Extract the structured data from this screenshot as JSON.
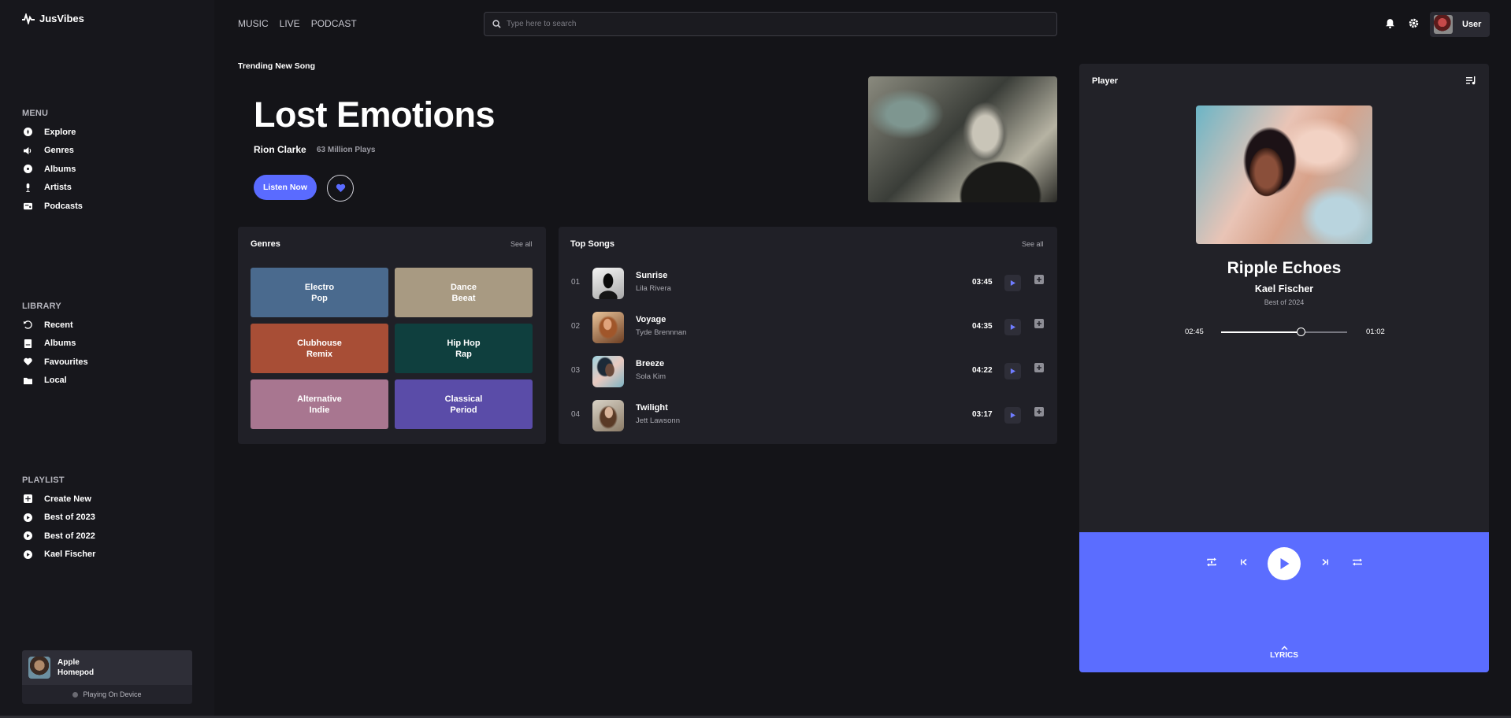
{
  "app": {
    "name": "JusVibes"
  },
  "sidebar": {
    "menu_title": "MENU",
    "menu_items": [
      {
        "label": "Explore",
        "icon": "explore-icon"
      },
      {
        "label": "Genres",
        "icon": "speaker-icon"
      },
      {
        "label": "Albums",
        "icon": "disc-icon"
      },
      {
        "label": "Artists",
        "icon": "microphone-icon"
      },
      {
        "label": "Podcasts",
        "icon": "radio-icon"
      }
    ],
    "library_title": "LIBRARY",
    "library_items": [
      {
        "label": "Recent",
        "icon": "history-icon"
      },
      {
        "label": "Albums",
        "icon": "album-icon"
      },
      {
        "label": "Favourites",
        "icon": "heart-icon"
      },
      {
        "label": "Local",
        "icon": "folder-icon"
      }
    ],
    "playlist_title": "PLAYLIST",
    "playlist_items": [
      {
        "label": "Create New",
        "icon": "plus-icon"
      },
      {
        "label": "Best of 2023",
        "icon": "play-circle-icon"
      },
      {
        "label": "Best of 2022",
        "icon": "play-circle-icon"
      },
      {
        "label": "Kael Fischer",
        "icon": "play-circle-icon"
      }
    ],
    "device": {
      "name": "Apple Homepod",
      "status": "Playing On Device"
    }
  },
  "topbar": {
    "nav": [
      "MUSIC",
      "LIVE",
      "PODCAST"
    ],
    "search_placeholder": "Type here to search",
    "user_label": "User"
  },
  "hero": {
    "label": "Trending New Song",
    "title": "Lost Emotions",
    "artist": "Rion Clarke",
    "plays": "63 Million Plays",
    "listen_label": "Listen Now"
  },
  "genres": {
    "title": "Genres",
    "see_all": "See all",
    "items": [
      {
        "label": "Electro\nPop",
        "color": "#4a6a8e"
      },
      {
        "label": "Dance\nBeeat",
        "color": "#a89a82"
      },
      {
        "label": "Clubhouse\nRemix",
        "color": "#a84e36"
      },
      {
        "label": "Hip Hop\nRap",
        "color": "#0f3f3e"
      },
      {
        "label": "Alternative\nIndie",
        "color": "#a87690"
      },
      {
        "label": "Classical\nPeriod",
        "color": "#5a4ca8"
      }
    ]
  },
  "top_songs": {
    "title": "Top Songs",
    "see_all": "See all",
    "items": [
      {
        "num": "01",
        "title": "Sunrise",
        "artist": "Lila Rivera",
        "duration": "03:45"
      },
      {
        "num": "02",
        "title": "Voyage",
        "artist": "Tyde Brennnan",
        "duration": "04:35"
      },
      {
        "num": "03",
        "title": "Breeze",
        "artist": "Sola Kim",
        "duration": "04:22"
      },
      {
        "num": "04",
        "title": "Twilight",
        "artist": "Jett Lawsonn",
        "duration": "03:17"
      }
    ]
  },
  "player": {
    "label": "Player",
    "track_title": "Ripple Echoes",
    "track_artist": "Kael Fischer",
    "album": "Best of 2024",
    "elapsed": "02:45",
    "remaining": "01:02",
    "progress": 0.63,
    "lyrics_label": "LYRICS",
    "accent": "#5b6dff"
  }
}
